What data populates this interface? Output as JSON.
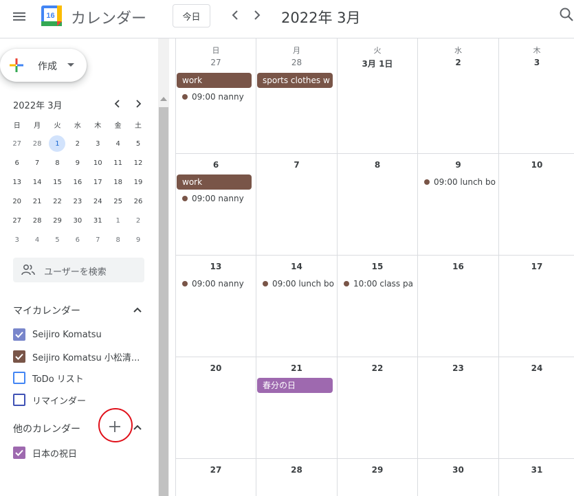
{
  "header": {
    "app_title": "カレンダー",
    "logo_day": "16",
    "today_label": "今日",
    "month_title": "2022年 3月"
  },
  "sidebar": {
    "create_label": "作成",
    "mini_calendar": {
      "title": "2022年 3月",
      "weekdays": [
        "日",
        "月",
        "火",
        "水",
        "木",
        "金",
        "土"
      ],
      "weeks": [
        [
          "27",
          "28",
          "1",
          "2",
          "3",
          "4",
          "5"
        ],
        [
          "6",
          "7",
          "8",
          "9",
          "10",
          "11",
          "12"
        ],
        [
          "13",
          "14",
          "15",
          "16",
          "17",
          "18",
          "19"
        ],
        [
          "20",
          "21",
          "22",
          "23",
          "24",
          "25",
          "26"
        ],
        [
          "27",
          "28",
          "29",
          "30",
          "31",
          "1",
          "2"
        ],
        [
          "3",
          "4",
          "5",
          "6",
          "7",
          "8",
          "9"
        ]
      ]
    },
    "search_users_placeholder": "ユーザーを検索",
    "my_calendars_title": "マイカレンダー",
    "my_calendars": [
      {
        "label": "Seijiro Komatsu",
        "color": "#7986cb",
        "checked": true
      },
      {
        "label": "Seijiro Komatsu 小松清...",
        "color": "#795548",
        "checked": true
      },
      {
        "label": "ToDo リスト",
        "color": "#4285f4",
        "checked": false
      },
      {
        "label": "リマインダー",
        "color": "#3f51b5",
        "checked": false
      }
    ],
    "other_calendars_title": "他のカレンダー",
    "other_calendars": [
      {
        "label": "日本の祝日",
        "color": "#9e69af",
        "checked": true
      }
    ]
  },
  "month": {
    "weekdays": [
      "日",
      "月",
      "火",
      "水",
      "木"
    ],
    "weeks": [
      {
        "days": [
          "27",
          "28",
          "3月 1日",
          "2",
          "3"
        ]
      },
      {
        "days": [
          "6",
          "7",
          "8",
          "9",
          "10"
        ]
      },
      {
        "days": [
          "13",
          "14",
          "15",
          "16",
          "17"
        ]
      },
      {
        "days": [
          "20",
          "21",
          "22",
          "23",
          "24"
        ]
      },
      {
        "days": [
          "27",
          "28",
          "29",
          "30",
          "31"
        ]
      }
    ],
    "events": {
      "w0_sun_chip": "work",
      "w0_sun_dot": "09:00 nanny",
      "w0_mon_chip": "sports clothes w",
      "w1_sun_chip": "work",
      "w1_sun_dot": "09:00 nanny",
      "w1_thu_dot": "09:00 lunch bo",
      "w2_sun_dot": "09:00 nanny",
      "w2_mon_dot": "09:00 lunch bo",
      "w2_tue_dot": "10:00 class pa",
      "w3_mon_chip": "春分の日"
    },
    "colors": {
      "event_brown": "#795548",
      "holiday_purple": "#9e69af",
      "today_highlight": "#d2e3fc"
    }
  }
}
